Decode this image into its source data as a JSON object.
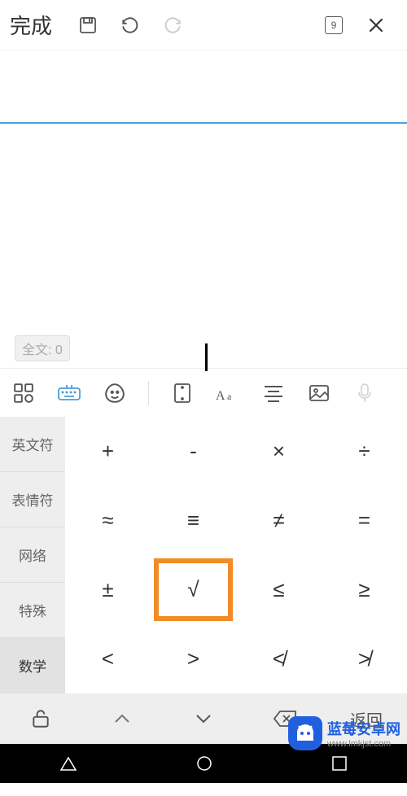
{
  "topbar": {
    "done_label": "完成",
    "page_num": "9"
  },
  "editor": {
    "word_count_label": "全文: 0"
  },
  "categories": [
    "英文符",
    "表情符",
    "网络",
    "特殊",
    "数学"
  ],
  "active_category_index": 4,
  "symbols": [
    "+",
    "-",
    "×",
    "÷",
    "≈",
    "≡",
    "≠",
    "=",
    "±",
    "√",
    "≤",
    "≥",
    "<",
    ">",
    "≮",
    "≯"
  ],
  "highlighted_symbol_index": 9,
  "bottom": {
    "return_label": "返回"
  },
  "watermark": {
    "line1": "蓝莓安卓网",
    "line2": "www.lmkjst.com"
  }
}
